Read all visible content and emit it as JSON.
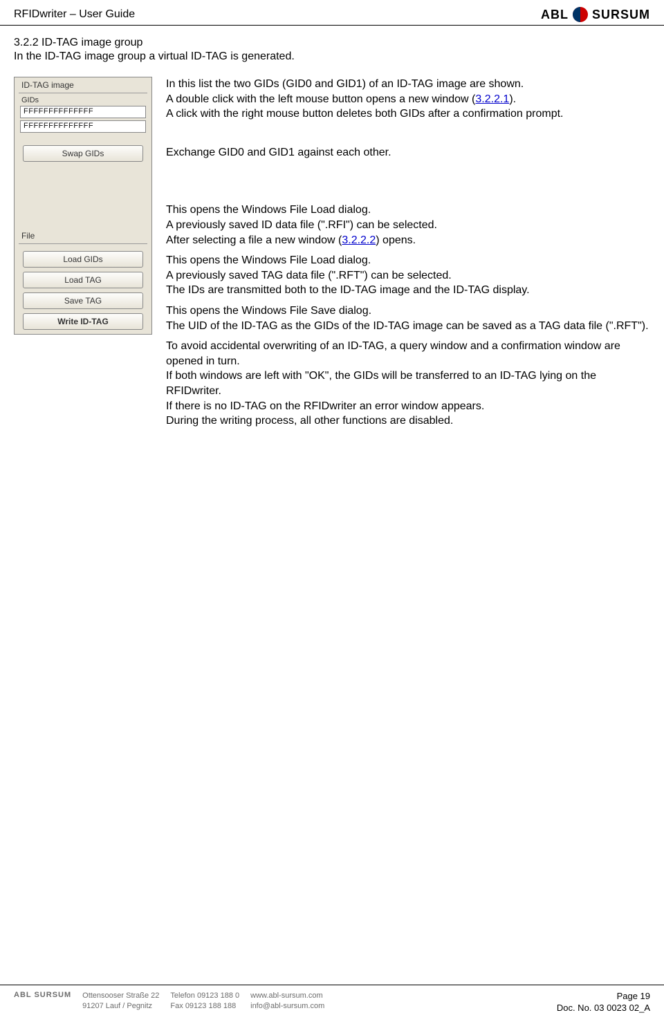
{
  "header": {
    "title": "RFIDwriter – User Guide",
    "logo_left": "ABL",
    "logo_right": "SURSUM"
  },
  "section": {
    "number_title": "3.2.2 ID-TAG image group",
    "intro": "In the ID-TAG image group a virtual ID-TAG is generated."
  },
  "panel": {
    "top_label": "ID-TAG image",
    "gids_label": "GIDs",
    "gid0": "FFFFFFFFFFFFFF",
    "gid1": "FFFFFFFFFFFFFF",
    "swap_btn": "Swap GIDs",
    "file_label": "File",
    "load_gids_btn": "Load GIDs",
    "load_tag_btn": "Load TAG",
    "save_tag_btn": "Save TAG",
    "write_btn": "Write ID-TAG"
  },
  "body": {
    "p1a": "In this list the two GIDs (GID0 and GID1) of an ID-TAG image are shown.",
    "p1b_pre": "A double click with the left mouse button opens a new window (",
    "p1b_link": "3.2.2.1",
    "p1b_post": ").",
    "p1c": "A click with the right mouse button deletes both GIDs after a confirmation prompt.",
    "p2": "Exchange GID0 and GID1 against each other.",
    "p3a": "This opens the Windows File Load dialog.",
    "p3b": "A previously saved ID data file (\".RFI\") can be selected.",
    "p3c_pre": "After selecting a file a new window (",
    "p3c_link": "3.2.2.2",
    "p3c_post": ") opens.",
    "p4a": "This opens the Windows File Load dialog.",
    "p4b": "A previously saved TAG data file (\".RFT\") can be selected.",
    "p4c": "The IDs are transmitted both to the ID-TAG image and the ID-TAG display.",
    "p5a": "This opens the Windows File Save dialog.",
    "p5b": "The UID of the ID-TAG as the GIDs of the ID-TAG image can be saved as a TAG data file (\".RFT\").",
    "p6a": "To avoid accidental overwriting of an ID-TAG, a query window and a confirmation window are opened in turn.",
    "p6b": "If both windows are left with \"OK\", the GIDs will be transferred to an ID-TAG lying on the RFIDwriter.",
    "p6c": "If there is no ID-TAG on the RFIDwriter an error window appears.",
    "p6d": "During the writing process, all other functions are disabled."
  },
  "footer": {
    "brand": "ABL SURSUM",
    "addr1": "Ottensooser Straße 22",
    "addr2": "91207 Lauf / Pegnitz",
    "tel": "Telefon 09123 188 0",
    "fax": "Fax 09123 188 188",
    "web": "www.abl-sursum.com",
    "mail": "info@abl-sursum.com",
    "page": "Page 19",
    "doc": "Doc. No. 03 0023 02_A"
  }
}
